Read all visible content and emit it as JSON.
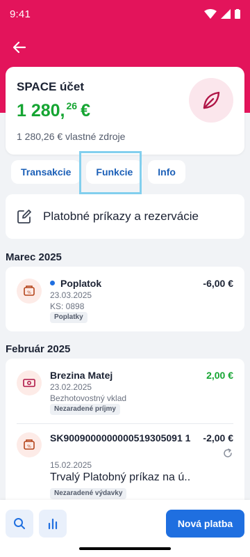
{
  "status": {
    "time": "9:41"
  },
  "account": {
    "name": "SPACE účet",
    "balance_int": "1 280,",
    "balance_dec": "26",
    "currency": "€",
    "own_funds": "1 280,26 € vlastné zdroje",
    "avatar_icon": "leaf-icon",
    "balance_color": "#15a532"
  },
  "tabs": [
    {
      "label": "Transakcie"
    },
    {
      "label": "Funkcie"
    },
    {
      "label": "Info"
    }
  ],
  "orders": {
    "label": "Platobné príkazy a rezervácie",
    "icon": "edit-icon"
  },
  "sections": [
    {
      "month": "Marec 2025",
      "items": [
        {
          "title": "Poplatok",
          "amount": "-6,00 €",
          "date": "23.03.2025",
          "detail": "KS: 0898",
          "tag": "Poplatky",
          "icon": "fee-icon"
        }
      ]
    },
    {
      "month": "Február 2025",
      "items": [
        {
          "title": "Brezina Matej",
          "amount": "2,00 €",
          "date": "23.02.2025",
          "detail": "Bezhotovostný vklad",
          "tag": "Nezaradené príjmy",
          "icon": "cash-icon"
        },
        {
          "title": "SK9009000000000519305091 1",
          "amount": "-2,00 €",
          "date": "15.02.2025",
          "detail": "Trvalý Platobný príkaz na ú..",
          "tag": "Nezaradené výdavky",
          "icon": "fee-icon"
        }
      ]
    }
  ],
  "bottom": {
    "primary_label": "Nová platba",
    "search_icon": "search-icon",
    "stats_icon": "bar-chart-icon"
  },
  "colors": {
    "brand": "#e3145b",
    "accent": "#1f6fe0",
    "positive": "#15a532"
  }
}
